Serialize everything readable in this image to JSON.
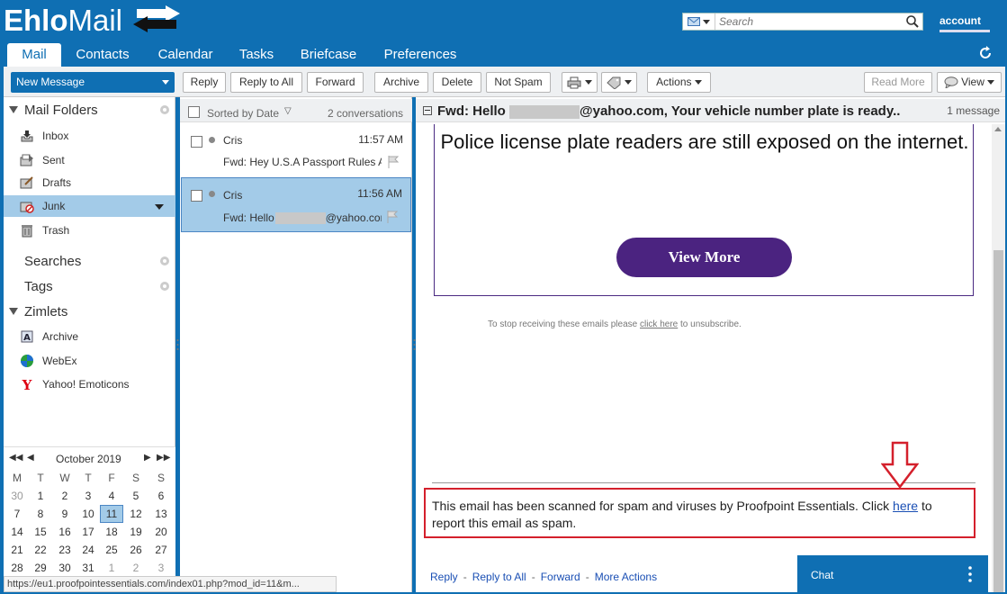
{
  "header": {
    "logo_a": "Ehlo",
    "logo_b": "Mail",
    "search_placeholder": "Search",
    "account_label": "account"
  },
  "tabs": [
    {
      "label": "Mail",
      "active": true
    },
    {
      "label": "Contacts"
    },
    {
      "label": "Calendar"
    },
    {
      "label": "Tasks"
    },
    {
      "label": "Briefcase"
    },
    {
      "label": "Preferences"
    }
  ],
  "toolbar": {
    "new_message": "New Message",
    "reply": "Reply",
    "reply_all": "Reply to All",
    "forward": "Forward",
    "archive": "Archive",
    "delete": "Delete",
    "not_spam": "Not Spam",
    "actions": "Actions",
    "read_more": "Read More",
    "view": "View"
  },
  "sidebar": {
    "mail_folders": "Mail Folders",
    "folders": [
      {
        "label": "Inbox",
        "icon": "inbox-icon"
      },
      {
        "label": "Sent",
        "icon": "sent-icon"
      },
      {
        "label": "Drafts",
        "icon": "drafts-icon"
      },
      {
        "label": "Junk",
        "icon": "junk-icon",
        "selected": true
      },
      {
        "label": "Trash",
        "icon": "trash-icon"
      }
    ],
    "searches": "Searches",
    "tags": "Tags",
    "zimlets": "Zimlets",
    "zimlet_items": [
      {
        "label": "Archive",
        "icon": "archive-zimlet-icon"
      },
      {
        "label": "WebEx",
        "icon": "webex-icon"
      },
      {
        "label": "Yahoo! Emoticons",
        "icon": "yahoo-icon"
      }
    ]
  },
  "calendar": {
    "title": "October 2019",
    "dow": [
      "M",
      "T",
      "W",
      "T",
      "F",
      "S",
      "S"
    ],
    "weeks": [
      [
        "30",
        "1",
        "2",
        "3",
        "4",
        "5",
        "6"
      ],
      [
        "7",
        "8",
        "9",
        "10",
        "11",
        "12",
        "13"
      ],
      [
        "14",
        "15",
        "16",
        "17",
        "18",
        "19",
        "20"
      ],
      [
        "21",
        "22",
        "23",
        "24",
        "25",
        "26",
        "27"
      ],
      [
        "28",
        "29",
        "30",
        "31",
        "1",
        "2",
        "3"
      ]
    ],
    "today": "11"
  },
  "list": {
    "sorted_by": "Sorted by Date",
    "count": "2 conversations",
    "rows": [
      {
        "from": "Cris",
        "time": "11:57 AM",
        "subject": "Fwd: Hey U.S.A Passport Rules Ar"
      },
      {
        "from": "Cris",
        "time": "11:56 AM",
        "subject_a": "Fwd: Hello",
        "subject_b": "@yahoo.cor"
      }
    ]
  },
  "reader": {
    "subject_a": "Fwd: Hello",
    "subject_b": "@yahoo.com, Your vehicle number plate is ready..",
    "msg_count": "1 message",
    "promo_text": "Police license plate readers are still exposed on the internet.",
    "view_more": "View More",
    "unsub_a": "To stop receiving these emails please ",
    "unsub_link": "click here",
    "unsub_b": " to unsubscribe.",
    "pp_a": "This email has been scanned for spam and viruses by Proofpoint Essentials. Click ",
    "pp_link": "here",
    "pp_b": " to report this email as spam.",
    "act_reply": "Reply",
    "act_reply_all": "Reply to All",
    "act_forward": "Forward",
    "act_more": "More Actions"
  },
  "chat": {
    "label": "Chat"
  },
  "status_url": "https://eu1.proofpointessentials.com/index01.php?mod_id=11&m...",
  "colors": {
    "brand": "#0f6fb3",
    "selection": "#a3cbe8",
    "promo_button": "#4b2380",
    "highlight_box": "#d4202c"
  }
}
